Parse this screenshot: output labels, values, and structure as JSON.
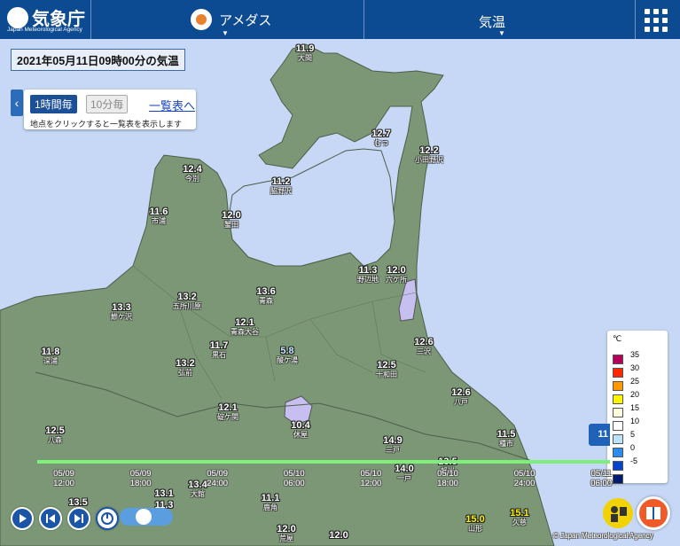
{
  "header": {
    "logo_text": "気象庁",
    "logo_en": "Japan Meteorological Agency",
    "service_label": "アメダス",
    "element_label": "気温",
    "menu_icon": "grid-menu-icon"
  },
  "title": "2021年05月11日09時00分の気温",
  "panel": {
    "btn_hourly": "1時間毎",
    "btn_10min": "10分毎",
    "link_list": "一覧表へ",
    "hint": "地点をクリックすると一覧表を表示します"
  },
  "stations": [
    {
      "v": "11.9",
      "n": "大間"
    },
    {
      "v": "12.7",
      "n": "むつ"
    },
    {
      "v": "12.2",
      "n": "小田野沢"
    },
    {
      "v": "11.2",
      "n": "脇野沢"
    },
    {
      "v": "12.4",
      "n": "今別"
    },
    {
      "v": "11.6",
      "n": "市浦"
    },
    {
      "v": "12.0",
      "n": "蟹田"
    },
    {
      "v": "11.3",
      "n": "野辺地"
    },
    {
      "v": "12.0",
      "n": "六ケ所"
    },
    {
      "v": "13.3",
      "n": "鰺ケ沢"
    },
    {
      "v": "13.2",
      "n": "五所川原"
    },
    {
      "v": "13.6",
      "n": "青森"
    },
    {
      "v": "12.1",
      "n": "青森大谷"
    },
    {
      "v": "11.7",
      "n": "黒石"
    },
    {
      "v": "5.8",
      "n": "酸ケ湯"
    },
    {
      "v": "12.6",
      "n": "三沢"
    },
    {
      "v": "11.8",
      "n": "深浦"
    },
    {
      "v": "13.2",
      "n": "弘前"
    },
    {
      "v": "12.5",
      "n": "十和田"
    },
    {
      "v": "12.6",
      "n": "八戸"
    },
    {
      "v": "12.1",
      "n": "碇ケ関"
    },
    {
      "v": "10.4",
      "n": "休屋"
    },
    {
      "v": "12.5",
      "n": "八森"
    },
    {
      "v": "14.9",
      "n": "三戸"
    },
    {
      "v": "11.5",
      "n": "種市"
    },
    {
      "v": "14.0",
      "n": "一戸"
    },
    {
      "v": "13.5",
      "n": "軽米"
    },
    {
      "v": "13.1",
      "n": ""
    },
    {
      "v": "13.5",
      "n": ""
    },
    {
      "v": "13.4",
      "n": "大館"
    },
    {
      "v": "11.3",
      "n": ""
    },
    {
      "v": "11.1",
      "n": "鹿角"
    },
    {
      "v": "15.0",
      "n": "山形"
    },
    {
      "v": "15.1",
      "n": "久慈"
    },
    {
      "v": "12.0",
      "n": "荒屋"
    },
    {
      "v": "12.0",
      "n": ""
    }
  ],
  "legend": {
    "unit": "℃",
    "items": [
      {
        "color": "#b4005a",
        "label": "35"
      },
      {
        "color": "#ff2800",
        "label": "30"
      },
      {
        "color": "#ff9900",
        "label": "25"
      },
      {
        "color": "#fff500",
        "label": "20"
      },
      {
        "color": "#ffffdd",
        "label": "15"
      },
      {
        "color": "#ffffff",
        "label": "10"
      },
      {
        "color": "#bae3ff",
        "label": "5"
      },
      {
        "color": "#2a8bf0",
        "label": "0"
      },
      {
        "color": "#0043cc",
        "label": "-5"
      },
      {
        "color": "#001c6f",
        "label": ""
      }
    ]
  },
  "timeline": {
    "current": "11",
    "ticks": [
      {
        "d": "05/09",
        "t": "12:00"
      },
      {
        "d": "05/09",
        "t": "18:00"
      },
      {
        "d": "05/09",
        "t": "24:00"
      },
      {
        "d": "05/10",
        "t": "06:00"
      },
      {
        "d": "05/10",
        "t": "12:00"
      },
      {
        "d": "05/10",
        "t": "18:00"
      },
      {
        "d": "05/10",
        "t": "24:00"
      },
      {
        "d": "05/11",
        "t": "06:00"
      }
    ]
  },
  "credit": "© Japan Meteorological Agency",
  "colors": {
    "header_bg": "#0c4a92",
    "land": "#7c9776",
    "sea": "#c6d8f5",
    "lake": "#c7bff0",
    "timeline": "#7df07a"
  }
}
